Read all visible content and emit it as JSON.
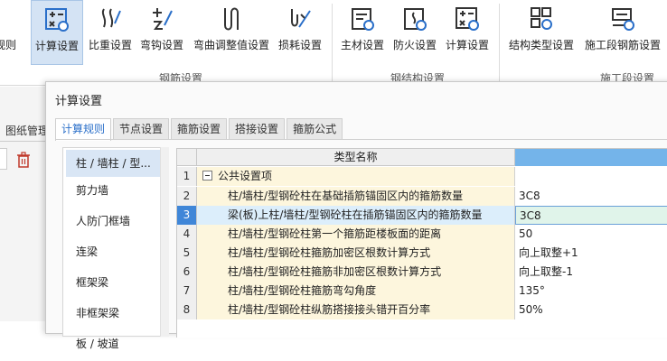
{
  "ribbon": {
    "cut_label": "规则",
    "buttons": [
      {
        "label": "计算设置",
        "icon": "calc-settings-icon"
      },
      {
        "label": "比重设置",
        "icon": "weight-ratio-icon"
      },
      {
        "label": "弯钩设置",
        "icon": "hook-settings-icon"
      },
      {
        "label": "弯曲调整值设置",
        "icon": "bend-adjust-icon"
      },
      {
        "label": "损耗设置",
        "icon": "loss-settings-icon"
      },
      {
        "label": "主材设置",
        "icon": "main-material-icon"
      },
      {
        "label": "防火设置",
        "icon": "fire-protection-icon"
      },
      {
        "label": "计算设置",
        "icon": "calc-settings-icon"
      },
      {
        "label": "结构类型设置",
        "icon": "structure-type-icon"
      },
      {
        "label": "施工段钢筋设置",
        "icon": "section-rebar-icon"
      }
    ],
    "groups": [
      "钢筋设置",
      "钢结构设置",
      "施工段设置"
    ]
  },
  "left_panel": {
    "tab_label": "图纸管理"
  },
  "dialog": {
    "title": "计算设置",
    "tabs": [
      "计算规则",
      "节点设置",
      "箍筋设置",
      "搭接设置",
      "箍筋公式"
    ],
    "categories": [
      "柱 / 墙柱 / 型...",
      "剪力墙",
      "人防门框墙",
      "连梁",
      "框架梁",
      "非框架梁",
      "板 / 坡道"
    ],
    "grid": {
      "header_name": "类型名称",
      "rows": [
        {
          "num": "1",
          "name": "公共设置项",
          "value": "",
          "group": true
        },
        {
          "num": "2",
          "name": "柱/墙柱/型钢砼柱在基础插筋锚固区内的箍筋数量",
          "value": "3C8"
        },
        {
          "num": "3",
          "name": "梁(板)上柱/墙柱/型钢砼柱在插筋锚固区内的箍筋数量",
          "value": "3C8",
          "selected": true
        },
        {
          "num": "4",
          "name": "柱/墙柱/型钢砼柱第一个箍筋距楼板面的距离",
          "value": "50"
        },
        {
          "num": "5",
          "name": "柱/墙柱/型钢砼柱箍筋加密区根数计算方式",
          "value": "向上取整+1"
        },
        {
          "num": "6",
          "name": "柱/墙柱/型钢砼柱箍筋非加密区根数计算方式",
          "value": "向上取整-1"
        },
        {
          "num": "7",
          "name": "柱/墙柱/型钢砼柱箍筋弯勾角度",
          "value": "135°"
        },
        {
          "num": "8",
          "name": "柱/墙柱/型钢砼柱纵筋搭接接头错开百分率",
          "value": "50%"
        }
      ]
    }
  },
  "colors": {
    "accent": "#2a6fc9",
    "header_value_col": "#74b4ea",
    "row_name_bg": "#fdf6dd",
    "selected_btn": "#d4e3f4"
  }
}
